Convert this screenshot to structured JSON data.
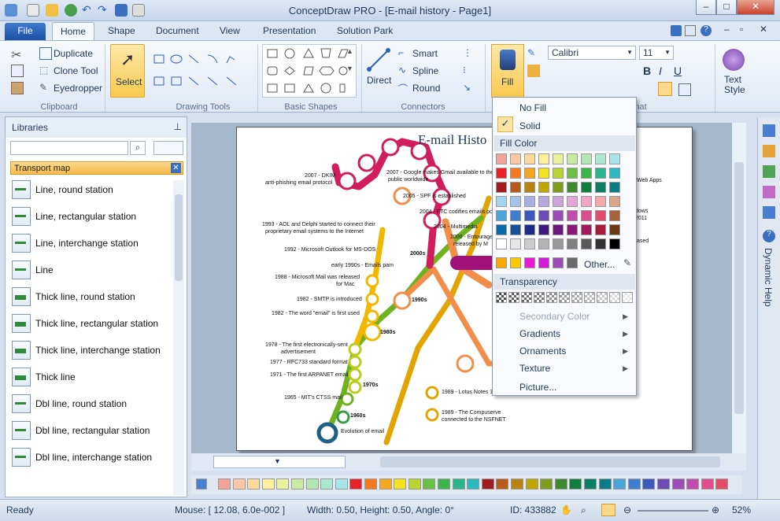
{
  "window": {
    "title": "ConceptDraw PRO - [E-mail history - Page1]",
    "min": "–",
    "max": "□",
    "close": "✕"
  },
  "tabs": {
    "file": "File",
    "home": "Home",
    "items": [
      "Shape",
      "Document",
      "View",
      "Presentation",
      "Solution Park"
    ]
  },
  "ribbon": {
    "clipboard": {
      "label": "Clipboard",
      "duplicate": "Duplicate",
      "clone": "Clone Tool",
      "eyedropper": "Eyedropper"
    },
    "select": "Select",
    "drawing_tools": "Drawing Tools",
    "basic_shapes": "Basic Shapes",
    "connectors": {
      "label": "Connectors",
      "direct": "Direct",
      "smart": "Smart",
      "spline": "Spline",
      "round": "Round"
    },
    "fill": "Fill",
    "font": {
      "name": "Calibri",
      "size": "11",
      "group": "nat"
    },
    "text_style": "Text Style"
  },
  "libraries": {
    "header": "Libraries",
    "section": "Transport map",
    "items": [
      "Line, round station",
      "Line, rectangular station",
      "Line, interchange station",
      "Line",
      "Thick line, round station",
      "Thick line, rectangular station",
      "Thick line, interchange station",
      "Thick line",
      "Dbl line, round station",
      "Dbl line, rectangular station",
      "Dbl line, interchange station"
    ]
  },
  "diagram": {
    "title": "E-mail Histo",
    "labels": [
      "2007 - DKIM",
      "anti-phishing email protocol",
      "2007 - Google makes Gmail available to the",
      "public worldwide",
      "2005 - SPF is established",
      "2004 - FTC codifies emails pol",
      "2004 - Multimedia",
      "2000 - Entourage",
      "released by M",
      "2000s",
      "1993 - AOL and Delphi started to connect their",
      "proprietary email systems to the Internet",
      "1992 - Microsoft Outlook for MS-DOS",
      "early 1990s - Emails pam",
      "1990s",
      "1988 - Microsoft Mail was released",
      "for Mac",
      "1982 - SMTP is introduced",
      "1982 - The word \"email\" is first used",
      "1980s",
      "1978 - The first electronically-sent",
      "advertisement",
      "1977 - RFC733 standard format",
      "1971 - The first ARPANET email",
      "1970s",
      "1965 - MIT's CTSS mail",
      "1960s",
      "Evolution of email",
      "1989 - Lotus Notes 1",
      "1989 - The Compuserve",
      "connected to the NSFNET",
      "Web Apps",
      "dows",
      "2011",
      "ased"
    ]
  },
  "fill_menu": {
    "no_fill": "No Fill",
    "solid": "Solid",
    "fill_color": "Fill Color",
    "other": "Other...",
    "transparency": "Transparency",
    "secondary": "Secondary Color",
    "gradients": "Gradients",
    "ornaments": "Ornaments",
    "texture": "Texture",
    "picture": "Picture..."
  },
  "right_panel": {
    "dynamic_help": "Dynamic Help"
  },
  "status": {
    "ready": "Ready",
    "mouse": "Mouse: [ 12.08, 6.0e-002 ]",
    "size": "Width: 0.50,  Height: 0.50,  Angle: 0°",
    "id": "ID: 433882",
    "zoom": "52%"
  }
}
